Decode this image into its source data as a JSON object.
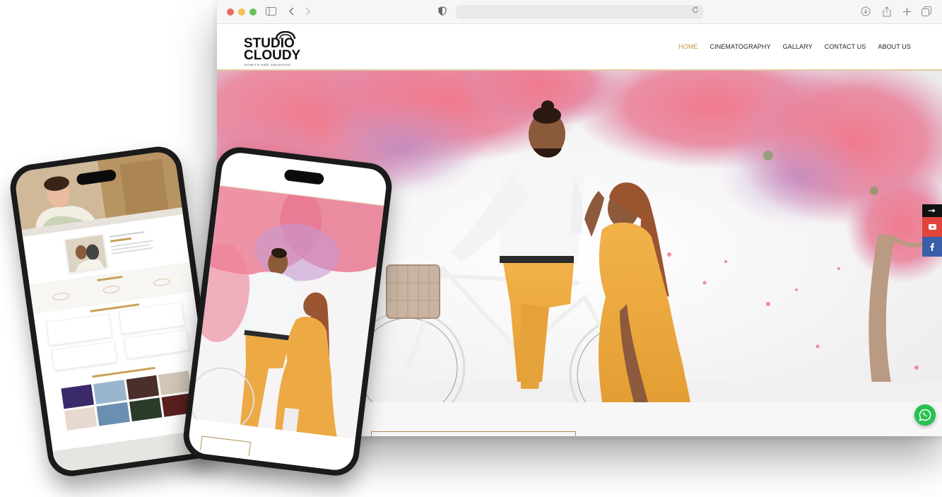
{
  "site": {
    "logo_line1": "STUDIO",
    "logo_line2": "CLOUDY",
    "logo_tagline": "RUWITH AND ANUSHIKA"
  },
  "nav": {
    "items": [
      {
        "label": "HOME",
        "active": true
      },
      {
        "label": "CINEMATOGRAPHY",
        "active": false
      },
      {
        "label": "GALLARY",
        "active": false
      },
      {
        "label": "CONTACT US",
        "active": false
      },
      {
        "label": "ABOUT US",
        "active": false
      }
    ]
  },
  "browser": {
    "traffic_lights": [
      "close",
      "minimize",
      "zoom"
    ],
    "toolbar_icons": [
      "sidebar-icon",
      "back-icon",
      "forward-icon",
      "shield-icon",
      "download-icon",
      "share-icon",
      "new-tab-icon",
      "tabs-icon"
    ],
    "address_value": ""
  },
  "social": {
    "items": [
      "arrow-icon",
      "youtube-icon",
      "facebook-icon"
    ]
  },
  "colors": {
    "accent": "#c2953b",
    "header_border": "#e3c9a6",
    "whatsapp": "#27c04f",
    "youtube": "#e0443b",
    "facebook": "#3b5ea8"
  }
}
